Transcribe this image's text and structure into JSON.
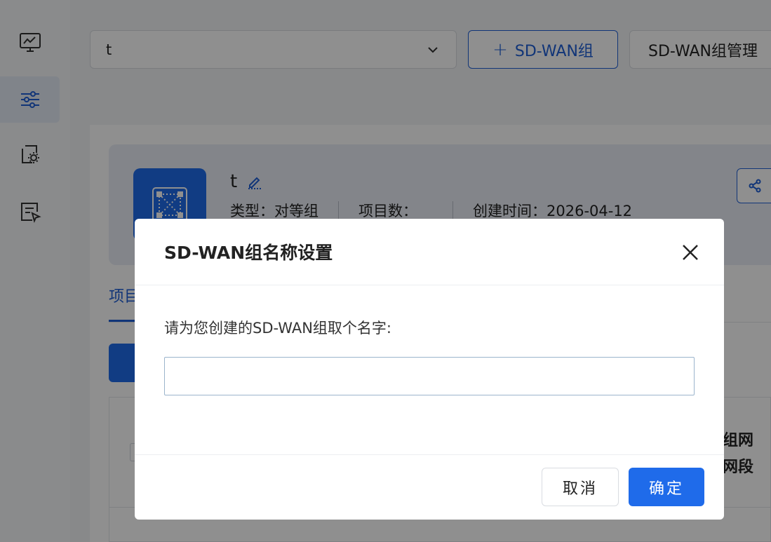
{
  "sidebar": {
    "items": [
      {
        "icon": "monitor-chart-icon"
      },
      {
        "icon": "sliders-icon",
        "active": true
      },
      {
        "icon": "gear-document-icon"
      },
      {
        "icon": "document-cursor-icon"
      }
    ]
  },
  "toolbar": {
    "group_select_value": "t",
    "add_group_label": "SD-WAN组",
    "manage_label": "SD-WAN组管理"
  },
  "group_card": {
    "name": "t",
    "type_text": "类型：对等组",
    "project_count_text": "项目数：",
    "created_text": "创建时间：2026-04-12"
  },
  "tabs": {
    "first_tab_fragment": "项目"
  },
  "table": {
    "column_fragment_1": "组网",
    "column_fragment_2": "网段"
  },
  "dialog": {
    "title": "SD-WAN组名称设置",
    "prompt": "请为您创建的SD-WAN组取个名字:",
    "input_value": "",
    "cancel_label": "取消",
    "ok_label": "确定"
  },
  "colors": {
    "primary": "#1f6bea",
    "border_blue": "#1f5fd6"
  }
}
